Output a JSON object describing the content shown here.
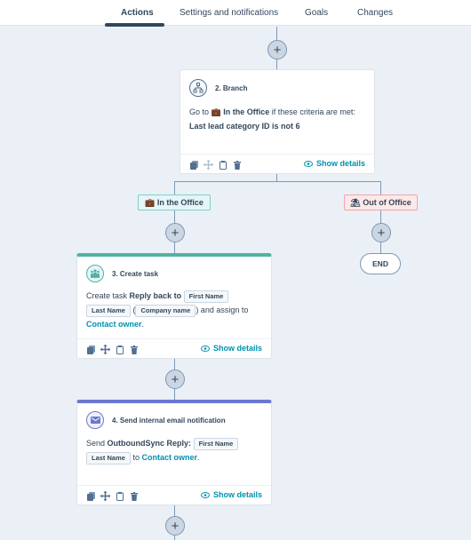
{
  "tabs": [
    {
      "label": "Actions",
      "active": true
    },
    {
      "label": "Settings and notifications",
      "active": false
    },
    {
      "label": "Goals",
      "active": false
    },
    {
      "label": "Changes",
      "active": false
    }
  ],
  "branch_card": {
    "title": "2. Branch",
    "icon": "branch-icon",
    "text_prefix": "Go to",
    "branch_emoji": "💼",
    "branch_name": "In the Office",
    "text_suffix": "if these criteria are met:",
    "criteria": "Last lead category ID is not 6",
    "show_details": "Show details"
  },
  "branches": [
    {
      "emoji": "💼",
      "label": "In the Office",
      "color": "#7fd1c7"
    },
    {
      "emoji": "⛱",
      "label": "Out of Office",
      "color": "#f2a4ac"
    }
  ],
  "end_label": "END",
  "task_card": {
    "title": "3. Create task",
    "icon": "task-icon",
    "accent": "#4fb3a0",
    "prefix": "Create task",
    "task_name": "Reply back to",
    "token_first": "First Name",
    "token_last": "Last Name",
    "open_paren": "(",
    "token_company": "Company name",
    "assign_text": ") and assign to",
    "owner": "Contact owner",
    "period": ".",
    "show_details": "Show details"
  },
  "email_card": {
    "title": "4. Send internal email notification",
    "icon": "email-icon",
    "accent": "#6a78d1",
    "prefix": "Send",
    "email_name": "OutboundSync Reply:",
    "token_first": "First Name",
    "token_last": "Last Name",
    "to_text": "to",
    "owner": "Contact owner",
    "period": ".",
    "show_details": "Show details"
  },
  "plus_label": "+"
}
